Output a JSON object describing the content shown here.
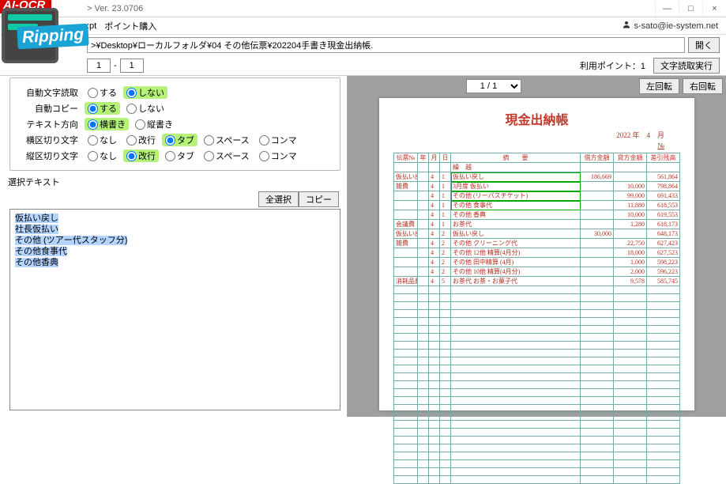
{
  "window": {
    "version_label": "> Ver. 23.0706",
    "min": "—",
    "max": "□",
    "close": "×"
  },
  "toolbar": {
    "pt_label": ":pt",
    "point_purchase": "ポイント購入",
    "user": "s-sato@ie-system.net"
  },
  "path": {
    "value": ">¥Desktop¥ローカルフォルダ¥04 その他伝票¥202204手書き現金出納帳.",
    "open_btn": "開く"
  },
  "page": {
    "from": "1",
    "to": "1",
    "sep": "-",
    "points_label": "利用ポイント：",
    "points_value": "1",
    "run_btn": "文字読取実行"
  },
  "opts": {
    "auto_read_label": "自動文字読取",
    "auto_copy_label": "自動コピー",
    "text_dir_label": "テキスト方向",
    "h_delim_label": "横区切り文字",
    "v_delim_label": "縦区切り文字",
    "do": "する",
    "dont": "しない",
    "hor": "横書き",
    "ver": "縦書き",
    "none": "なし",
    "lf": "改行",
    "tab": "タブ",
    "space": "スペース",
    "comma": "コンマ"
  },
  "sel": {
    "label": "選択テキスト",
    "select_all": "全選択",
    "copy": "コピー",
    "lines": [
      "仮払い戻し",
      "社長仮払い",
      "その他 (ツアー代スタッフ分)",
      "その他食事代",
      "その他香典"
    ]
  },
  "rtop": {
    "page_display": "1 / 1",
    "rot_l": "左回転",
    "rot_r": "右回転"
  },
  "doc": {
    "title": "現金出納帳",
    "date": "2022 年　4　月",
    "no_label": "№",
    "headers": [
      "伝票№",
      "年",
      "月",
      "日",
      "摘　　要",
      "借方金額",
      "貸方金額",
      "差引残高"
    ],
    "carry": "繰　越",
    "rows": [
      {
        "no": "仮払い戻し",
        "m": "4",
        "d": "1",
        "desc": "仮払い戻し",
        "dr": "186,669",
        "cr": "",
        "bal": "561,864",
        "green": true
      },
      {
        "no": "雑費",
        "m": "4",
        "d": "1",
        "desc": "3月度 仮払い",
        "dr": "",
        "cr": "10,000",
        "bal": "798,864",
        "green": true
      },
      {
        "no": "",
        "m": "4",
        "d": "1",
        "desc": "その他 (リーバスチケット)",
        "dr": "",
        "cr": "99,000",
        "bal": "691,433",
        "green": true
      },
      {
        "no": "",
        "m": "4",
        "d": "1",
        "desc": "その他 食事代",
        "dr": "",
        "cr": "11,880",
        "bal": "618,553",
        "green": true
      },
      {
        "no": "",
        "m": "4",
        "d": "1",
        "desc": "その他 香典",
        "dr": "",
        "cr": "10,000",
        "bal": "619,553"
      },
      {
        "no": "会議費",
        "m": "4",
        "d": "1",
        "desc": "お茶代",
        "dr": "",
        "cr": "1,280",
        "bal": "618,173"
      },
      {
        "no": "仮払い戻し",
        "m": "4",
        "d": "2",
        "desc": "仮払い戻し",
        "dr": "30,000",
        "cr": "",
        "bal": "648,173"
      },
      {
        "no": "雑費",
        "m": "4",
        "d": "2",
        "desc": "その他 クリーニング代",
        "dr": "",
        "cr": "22,750",
        "bal": "627,423"
      },
      {
        "no": "",
        "m": "4",
        "d": "2",
        "desc": "その他 12他 精算(4月分)",
        "dr": "",
        "cr": "18,000",
        "bal": "627,523"
      },
      {
        "no": "",
        "m": "4",
        "d": "2",
        "desc": "その他 田中精算 (4月)",
        "dr": "",
        "cr": "1,000",
        "bal": "598,223"
      },
      {
        "no": "",
        "m": "4",
        "d": "2",
        "desc": "その他 10他 精算(4月分)",
        "dr": "",
        "cr": "2,000",
        "bal": "596,223"
      },
      {
        "no": "消耗品費",
        "m": "4",
        "d": "5",
        "desc": "お茶代 お茶・お菓子代",
        "dr": "",
        "cr": "9,578",
        "bal": "585,745"
      }
    ],
    "empty_rows": 25
  }
}
